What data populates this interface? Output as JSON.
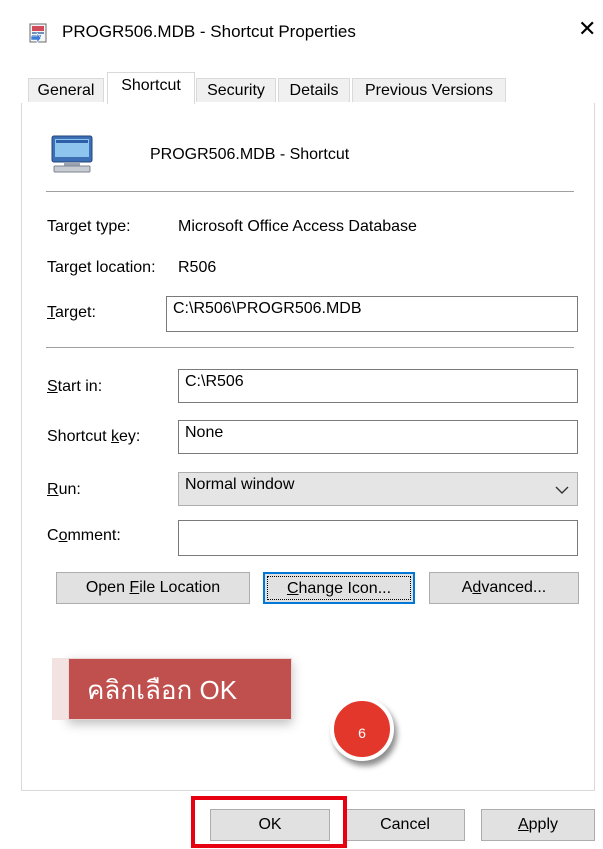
{
  "window": {
    "title": "PROGR506.MDB - Shortcut Properties",
    "close_glyph": "✕"
  },
  "tabs": [
    {
      "label": "General",
      "active": false
    },
    {
      "label": "Shortcut",
      "active": true
    },
    {
      "label": "Security",
      "active": false
    },
    {
      "label": "Details",
      "active": false
    },
    {
      "label": "Previous Versions",
      "active": false
    }
  ],
  "shortcut": {
    "icon": "monitor-icon",
    "name": "PROGR506.MDB - Shortcut",
    "target_type_label": "Target type:",
    "target_type_value": "Microsoft Office Access Database",
    "target_location_label": "Target location:",
    "target_location_value": "R506",
    "target_label_pre": "",
    "target_label_key": "T",
    "target_label_post": "arget:",
    "target_value": "C:\\R506\\PROGR506.MDB",
    "startin_label_key": "S",
    "startin_label_post": "tart in:",
    "startin_value": "C:\\R506",
    "shortcutkey_label_pre": "Shortcut ",
    "shortcutkey_label_key": "k",
    "shortcutkey_label_post": "ey:",
    "shortcutkey_value": "None",
    "run_label_key": "R",
    "run_label_post": "un:",
    "run_value": "Normal window",
    "comment_label_pre": "C",
    "comment_label_key": "o",
    "comment_label_post": "mment:",
    "comment_value": ""
  },
  "buttons": {
    "open_pre": "Open ",
    "open_key": "F",
    "open_post": "ile Location",
    "change_key": "C",
    "change_post": "hange Icon...",
    "advanced_pre": "A",
    "advanced_key": "d",
    "advanced_post": "vanced...",
    "ok": "OK",
    "cancel": "Cancel",
    "apply_key": "A",
    "apply_post": "pply"
  },
  "annotation": {
    "callout_text": "คลิกเลือก OK",
    "step_number": "6",
    "callout_color": "#c0504d",
    "badge_color": "#e4372b",
    "highlight_color": "#e60012"
  }
}
